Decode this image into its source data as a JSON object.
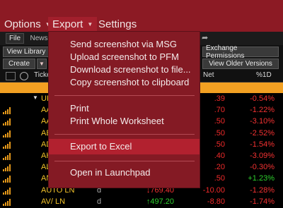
{
  "menubar": {
    "options": "Options",
    "export": "Export",
    "settings": "Settings"
  },
  "toolbar": {
    "file": "File",
    "news": "News",
    "view_library": "View Library",
    "create": "Create",
    "exchange_permissions": "Exchange Permissions",
    "view_older_versions": "View Older Versions"
  },
  "columns": {
    "ticker": "Ticke",
    "net": "Net",
    "pct": "%1D"
  },
  "rows": [
    {
      "ticker": "UK",
      "last": "",
      "net": ".39",
      "pct": "-0.54%",
      "pct_color": "red",
      "is_group": true
    },
    {
      "ticker": "AA",
      "last": "",
      "net": ".70",
      "pct": "-1.22%",
      "pct_color": "red"
    },
    {
      "ticker": "AA",
      "last": "",
      "net": ".50",
      "pct": "-3.10%",
      "pct_color": "red"
    },
    {
      "ticker": "AB",
      "last": "",
      "net": ".50",
      "pct": "-2.52%",
      "pct_color": "red"
    },
    {
      "ticker": "AD",
      "last": "",
      "net": ".50",
      "pct": "-1.54%",
      "pct_color": "red"
    },
    {
      "ticker": "AH",
      "last": "",
      "net": ".40",
      "pct": "-3.09%",
      "pct_color": "red"
    },
    {
      "ticker": "AL",
      "last": "",
      "net": ".20",
      "pct": "-0.30%",
      "pct_color": "red"
    },
    {
      "ticker": "AN",
      "last": "",
      "net": ".50",
      "pct": "+1.23%",
      "pct_color": "green"
    },
    {
      "ticker": "AUTO LN",
      "dflag": "d",
      "last": "↓769.40",
      "last_dir": "down",
      "net": "-10.00",
      "pct": "-1.28%",
      "pct_color": "red"
    },
    {
      "ticker": "AV/ LN",
      "dflag": "d",
      "last": "↑497.20",
      "last_dir": "up",
      "net": "-8.80",
      "pct": "-1.74%",
      "pct_color": "red"
    }
  ],
  "export_menu": {
    "send_msg": "Send screenshot via MSG",
    "upload_pfm": "Upload screenshot to PFM",
    "download_file": "Download screenshot to file...",
    "copy_clipboard": "Copy screenshot to clipboard",
    "print": "Print",
    "print_worksheet": "Print Whole Worksheet",
    "export_excel": "Export to Excel",
    "open_launchpad": "Open in Launchpad"
  },
  "colors": {
    "menubar": "#8c1a24",
    "dropdown": "#841a24",
    "highlight": "#b2212f",
    "header_band": "#f2a022",
    "negative": "#f43232",
    "positive": "#2ed02e"
  }
}
